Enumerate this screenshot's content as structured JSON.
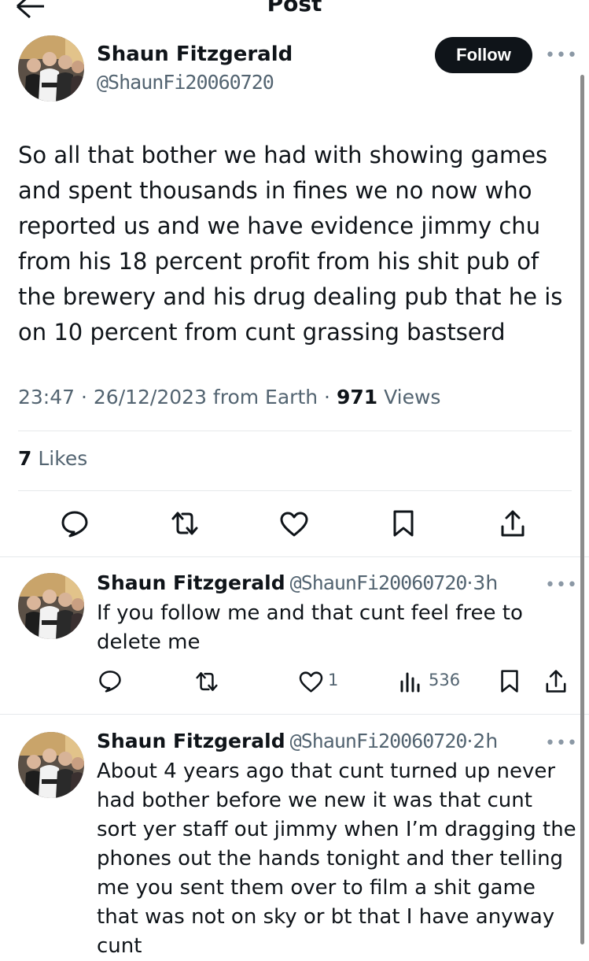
{
  "header": {
    "title": "Post"
  },
  "tweet": {
    "author": "Shaun Fitzgerald",
    "handle": "@ShaunFi20060720",
    "follow_label": "Follow",
    "more": "•••",
    "text": "So all that bother we had with showing games and spent thousands in fines we no now who reported us and we have evidence jimmy chu from his 18 percent profit from his shit pub of the brewery and his drug dealing pub that he is on 10 percent from cunt grassing bastserd",
    "time": "23:47 · 26/12/2023 from Earth · ",
    "views_count": "971",
    "views_label": " Views",
    "likes_count": "7",
    "likes_label": " Likes"
  },
  "replies": [
    {
      "author": "Shaun Fitzgerald",
      "handle": "@ShaunFi20060720",
      "age": "·3h",
      "more": "•••",
      "text": "If you follow me and that cunt feel free to delete me",
      "like_count": "1",
      "views_count": "536"
    },
    {
      "author": "Shaun Fitzgerald",
      "handle": "@ShaunFi20060720",
      "age": "·2h",
      "more": "•••",
      "text": "About 4 years ago that cunt turned up never had bother before we new it was that cunt sort yer staff out jimmy when I’m dragging the phones out the hands tonight and ther telling me you sent them over to film a shit game that was not on sky or bt that I have anyway cunt"
    }
  ],
  "colors": {
    "text": "#0f1419",
    "secondary": "#536471",
    "divider": "#e6e9eb"
  }
}
